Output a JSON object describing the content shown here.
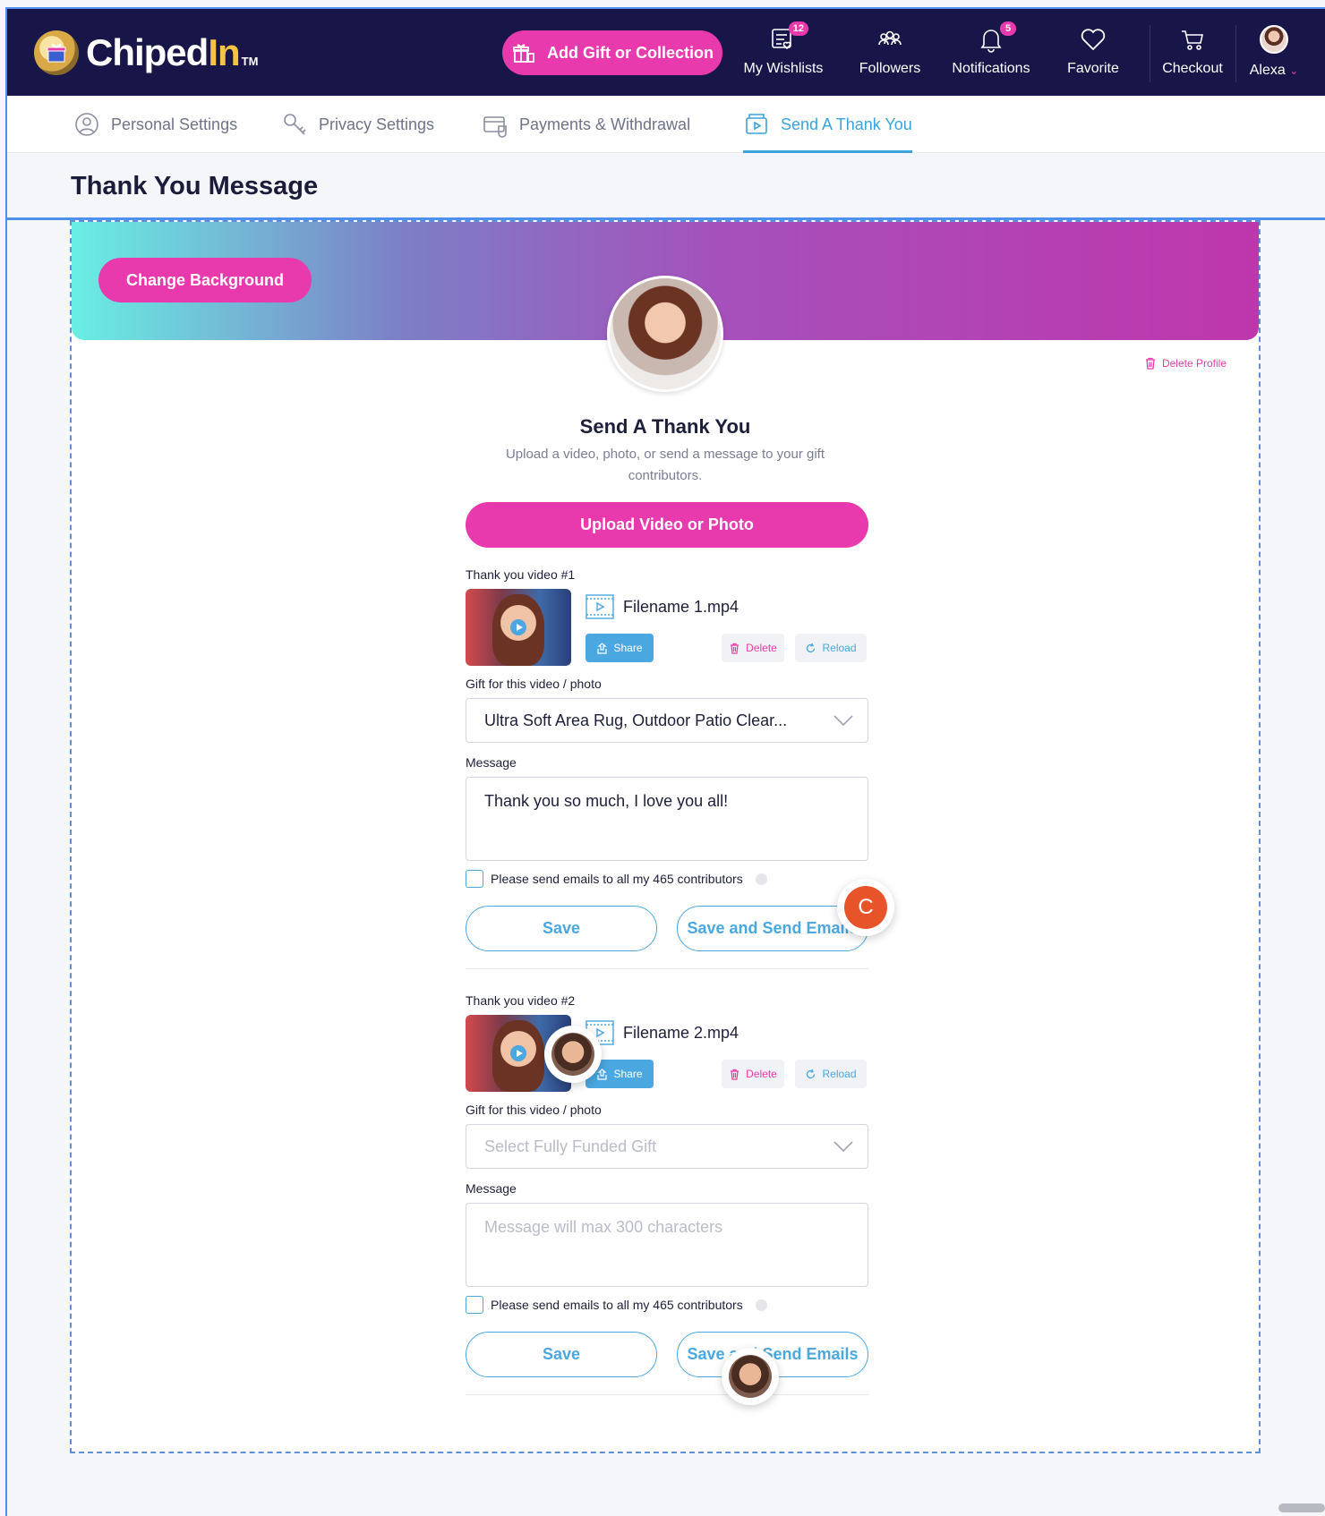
{
  "app": {
    "logo_main": "Chiped",
    "logo_accent": "In",
    "logo_tm": "TM"
  },
  "topnav": {
    "add_gift_label": "Add Gift or Collection",
    "items": [
      {
        "label": "My Wishlists",
        "icon": "wishlist-icon",
        "badge": "12"
      },
      {
        "label": "Followers",
        "icon": "followers-icon",
        "badge": ""
      },
      {
        "label": "Notifications",
        "icon": "bell-icon",
        "badge": "5"
      },
      {
        "label": "Favorite",
        "icon": "heart-icon",
        "badge": ""
      },
      {
        "label": "Checkout",
        "icon": "cart-icon",
        "badge": ""
      }
    ],
    "user_name": "Alexa"
  },
  "tabs": [
    {
      "label": "Personal Settings",
      "icon": "user-circle-icon"
    },
    {
      "label": "Privacy Settings",
      "icon": "key-icon"
    },
    {
      "label": "Payments & Withdrawal",
      "icon": "wallet-icon"
    },
    {
      "label": "Send A Thank You",
      "icon": "video-message-icon",
      "active": true
    }
  ],
  "page": {
    "title": "Thank You Message"
  },
  "banner": {
    "change_background_label": "Change Background",
    "delete_profile_label": "Delete Profile"
  },
  "thank_you": {
    "heading": "Send A Thank You",
    "subtitle": "Upload a video, photo, or send a message to your gift contributors.",
    "upload_label": "Upload Video or Photo"
  },
  "videos": [
    {
      "label": "Thank you video #1",
      "filename": "Filename 1.mp4",
      "share_label": "Share",
      "delete_label": "Delete",
      "reload_label": "Reload",
      "gift_label": "Gift for this video / photo",
      "gift_value": "Ultra Soft Area Rug, Outdoor Patio Clear...",
      "message_label": "Message",
      "message_value": "Thank you so much, I love you all!",
      "email_check_label": "Please send emails to all my 465 contributors",
      "save_label": "Save",
      "save_send_label": "Save and Send Emails"
    },
    {
      "label": "Thank you video #2",
      "filename": "Filename 2.mp4",
      "share_label": "Share",
      "delete_label": "Delete",
      "reload_label": "Reload",
      "gift_label": "Gift for this video / photo",
      "gift_placeholder": "Select Fully Funded Gift",
      "message_label": "Message",
      "message_placeholder": "Message will max 300 characters",
      "email_check_label": "Please send emails to all my 465 contributors",
      "save_label": "Save",
      "save_send_label": "Save and Send Emails"
    }
  ],
  "collaborators": {
    "c_initial": "C"
  },
  "colors": {
    "navy": "#181648",
    "pink": "#e93aad",
    "blue": "#4aa7e0",
    "gold": "#f6c445"
  }
}
